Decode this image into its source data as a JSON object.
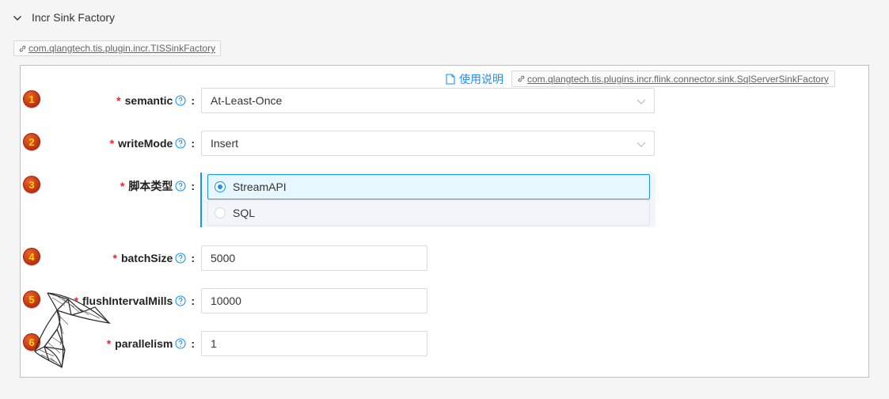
{
  "collapse": {
    "title": "Incr Sink Factory"
  },
  "plugin_tag": {
    "text": "com.qlangtech.tis.plugin.incr.TISSinkFactory"
  },
  "panel": {
    "doc_link": "使用说明",
    "impl_tag": "com.qlangtech.tis.plugins.incr.flink.connector.sink.SqlServerSinkFactory"
  },
  "fields": [
    {
      "step": "1",
      "required": "*",
      "label": "semantic",
      "colon": ":",
      "value": "At-Least-Once"
    },
    {
      "step": "2",
      "required": "*",
      "label": "writeMode",
      "colon": ":",
      "value": "Insert"
    },
    {
      "step": "3",
      "required": "*",
      "label": "脚本类型",
      "colon": ":",
      "options": [
        "StreamAPI",
        "SQL"
      ],
      "selected": "StreamAPI"
    },
    {
      "step": "4",
      "required": "*",
      "label": "batchSize",
      "colon": ":",
      "value": "5000"
    },
    {
      "step": "5",
      "required": "*",
      "label": "flushIntervalMills",
      "colon": ":",
      "value": "10000"
    },
    {
      "step": "6",
      "required": "*",
      "label": "parallelism",
      "colon": ":",
      "value": "1"
    }
  ],
  "colors": {
    "accent": "#1890ff",
    "required": "#f5222d",
    "step_badge": "#d0421a",
    "step_digit": "#ffd400"
  },
  "icons": {
    "collapse": "chevron-down-icon",
    "tag": "link-icon",
    "doc": "file-icon",
    "help": "question-circle-icon",
    "select": "chevron-down-icon",
    "logo": "sql-server-logo"
  }
}
